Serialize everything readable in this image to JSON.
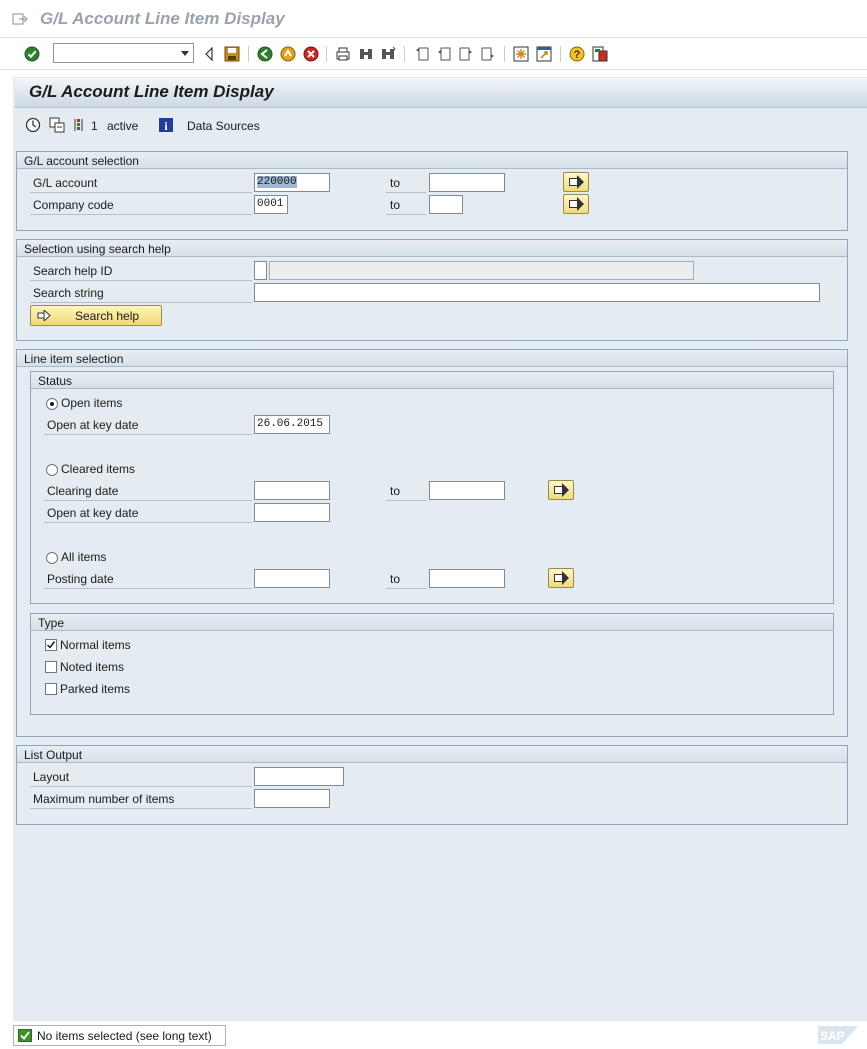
{
  "window": {
    "title": "G/L Account Line Item Display"
  },
  "page": {
    "title": "G/L Account Line Item Display"
  },
  "app_toolbar": {
    "selection_count": "1",
    "active_label": "active",
    "data_sources_label": "Data Sources"
  },
  "gl_account_selection": {
    "header": "G/L account selection",
    "gl_account_label": "G/L account",
    "gl_account_from": "220000",
    "gl_account_to": "",
    "company_code_label": "Company code",
    "company_code_from": "0001",
    "company_code_to": "",
    "to_label": "to"
  },
  "search_help_section": {
    "header": "Selection using search help",
    "search_help_id_label": "Search help ID",
    "search_help_id_value": "",
    "search_string_label": "Search string",
    "search_string_value": "",
    "button_label": "Search help"
  },
  "line_item_selection": {
    "header": "Line item selection",
    "status": {
      "header": "Status",
      "open_items_label": "Open items",
      "open_at_key_date_label": "Open at key date",
      "open_key_date_value": "26.06.2015",
      "cleared_items_label": "Cleared items",
      "clearing_date_label": "Clearing date",
      "clearing_date_from": "",
      "clearing_date_to": "",
      "cleared_open_at_key_date_label": "Open at key date",
      "cleared_open_key_date_value": "",
      "all_items_label": "All items",
      "posting_date_label": "Posting date",
      "posting_date_from": "",
      "posting_date_to": "",
      "selected": "open_items",
      "to_label": "to"
    },
    "type": {
      "header": "Type",
      "normal_items_label": "Normal items",
      "normal_items_checked": true,
      "noted_items_label": "Noted items",
      "noted_items_checked": false,
      "parked_items_label": "Parked items",
      "parked_items_checked": false
    }
  },
  "list_output": {
    "header": "List Output",
    "layout_label": "Layout",
    "layout_value": "",
    "max_items_label": "Maximum number of items",
    "max_items_value": ""
  },
  "status_bar": {
    "message": "No items selected (see long text)"
  },
  "colors": {
    "accent_yellow": "#f1dc7a",
    "panel_bg": "#e5ecf1",
    "group_border": "#8fa6bb",
    "ok_green": "#3f8f2a"
  },
  "icons": [
    "enter-icon",
    "back-icon",
    "save-icon",
    "exit-icon",
    "cancel-icon",
    "print-icon",
    "find-icon",
    "help-icon",
    "execute-icon",
    "variants-icon",
    "selection-icon",
    "info-icon"
  ]
}
